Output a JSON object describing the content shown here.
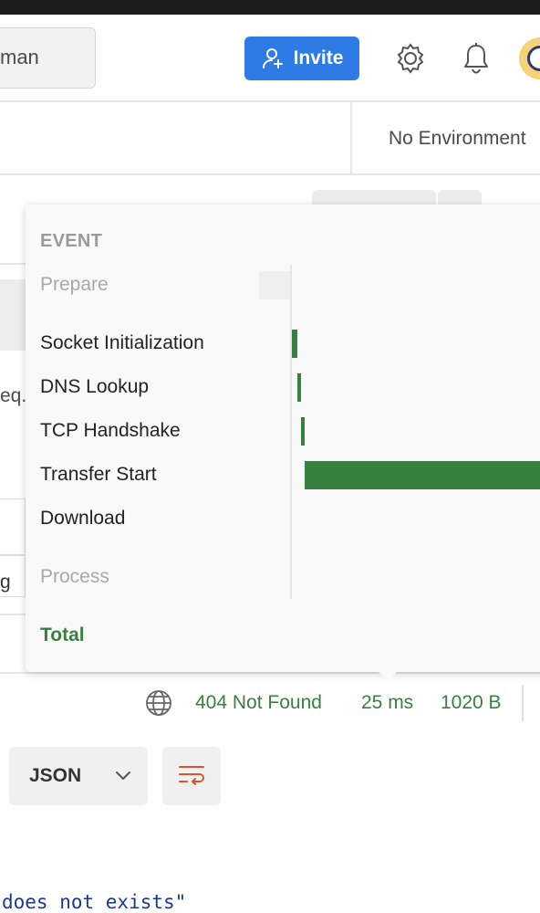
{
  "header": {
    "search_text": "man",
    "invite_label": "Invite",
    "icons": [
      "user-plus-icon",
      "gear-icon",
      "bell-icon",
      "avatar"
    ]
  },
  "environment": {
    "label": "No Environment"
  },
  "background": {
    "req_fragment": "eq.",
    "field_fragment": "g"
  },
  "timing_popover": {
    "header": "EVENT",
    "events": [
      {
        "label": "Prepare",
        "dim": true
      },
      {
        "label": "Socket Initialization",
        "dim": false
      },
      {
        "label": "DNS Lookup",
        "dim": false
      },
      {
        "label": "TCP Handshake",
        "dim": false
      },
      {
        "label": "Transfer Start",
        "dim": false
      },
      {
        "label": "Download",
        "dim": false
      },
      {
        "label": "Process",
        "dim": true
      }
    ],
    "total_label": "Total",
    "bar_color": "#388040"
  },
  "status_bar": {
    "status": "404 Not Found",
    "time": "25 ms",
    "size": "1020 B"
  },
  "response_toolbar": {
    "format": "JSON",
    "icons": [
      "chevron-down-icon",
      "wrap-lines-icon"
    ]
  },
  "response_body": {
    "visible_line": "does not exists\""
  }
}
